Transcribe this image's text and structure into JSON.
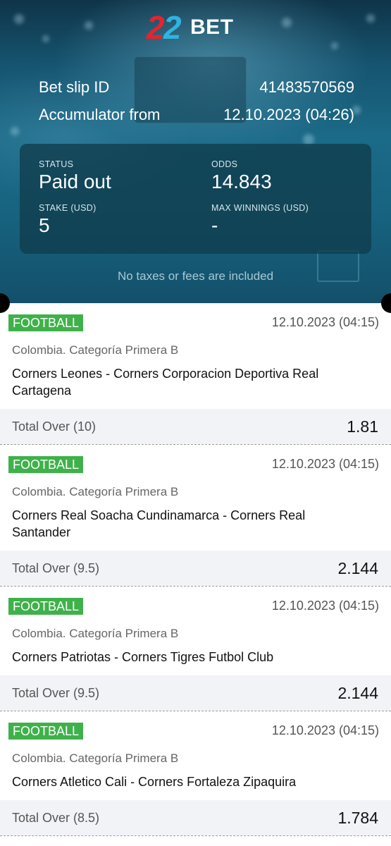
{
  "brand": {
    "logo_digits": "22",
    "logo_text": "BET"
  },
  "slip": {
    "id_label": "Bet slip ID",
    "id_value": "41483570569",
    "type_label": "Accumulator from",
    "type_value": "12.10.2023 (04:26)"
  },
  "summary": {
    "status_label": "STATUS",
    "status_value": "Paid out",
    "odds_label": "ODDS",
    "odds_value": "14.843",
    "stake_label": "STAKE (USD)",
    "stake_value": "5",
    "max_label": "MAX WINNINGS (USD)",
    "max_value": "-"
  },
  "notice": "No taxes or fees are included",
  "bets": [
    {
      "sport": "FOOTBALL",
      "date": "12.10.2023 (04:15)",
      "league": "Colombia. Categoría Primera B",
      "match": "Corners Leones - Corners Corporacion Deportiva Real Cartagena",
      "market": "Total Over (10)",
      "odd": "1.81"
    },
    {
      "sport": "FOOTBALL",
      "date": "12.10.2023 (04:15)",
      "league": "Colombia. Categoría Primera B",
      "match": "Corners Real Soacha Cundinamarca - Corners Real Santander",
      "market": "Total Over (9.5)",
      "odd": "2.144"
    },
    {
      "sport": "FOOTBALL",
      "date": "12.10.2023 (04:15)",
      "league": "Colombia. Categoría Primera B",
      "match": "Corners Patriotas - Corners Tigres Futbol Club",
      "market": "Total Over (9.5)",
      "odd": "2.144"
    },
    {
      "sport": "FOOTBALL",
      "date": "12.10.2023 (04:15)",
      "league": "Colombia. Categoría Primera B",
      "match": "Corners Atletico Cali - Corners Fortaleza Zipaquira",
      "market": "Total Over (8.5)",
      "odd": "1.784"
    }
  ],
  "colors": {
    "sport_badge": "#3fb14a",
    "logo_red": "#e8232c",
    "logo_blue": "#2fb3e0",
    "header_bg": "#1b6a87"
  }
}
